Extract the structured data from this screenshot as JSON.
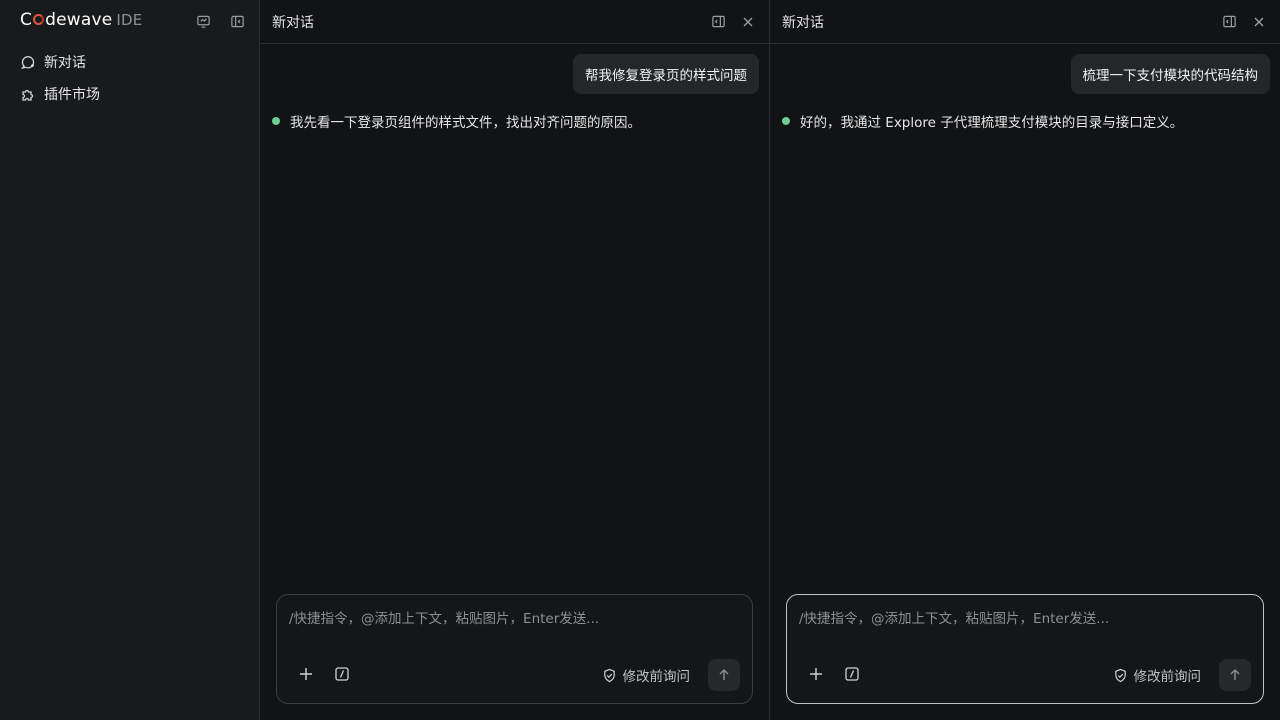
{
  "brand": {
    "first": "C",
    "rest": "dewave",
    "suffix": "IDE"
  },
  "sidebar": {
    "items": [
      {
        "label": "新对话"
      },
      {
        "label": "插件市场"
      }
    ]
  },
  "panels": [
    {
      "title": "新对话",
      "user_message": "帮我修复登录页的样式问题",
      "assistant_message": "我先看一下登录页组件的样式文件，找出对齐问题的原因。",
      "composer": {
        "placeholder": "/快捷指令，@添加上下文，粘贴图片，Enter发送...",
        "mode_label": "修改前询问"
      }
    },
    {
      "title": "新对话",
      "user_message": "梳理一下支付模块的代码结构",
      "assistant_message": "好的，我通过 Explore 子代理梳理支付模块的目录与接口定义。",
      "composer": {
        "placeholder": "/快捷指令，@添加上下文，粘贴图片，Enter发送...",
        "mode_label": "修改前询问"
      }
    }
  ],
  "colors": {
    "accent_dot": "#6ccf8e",
    "brand_o": "#e0533b"
  }
}
